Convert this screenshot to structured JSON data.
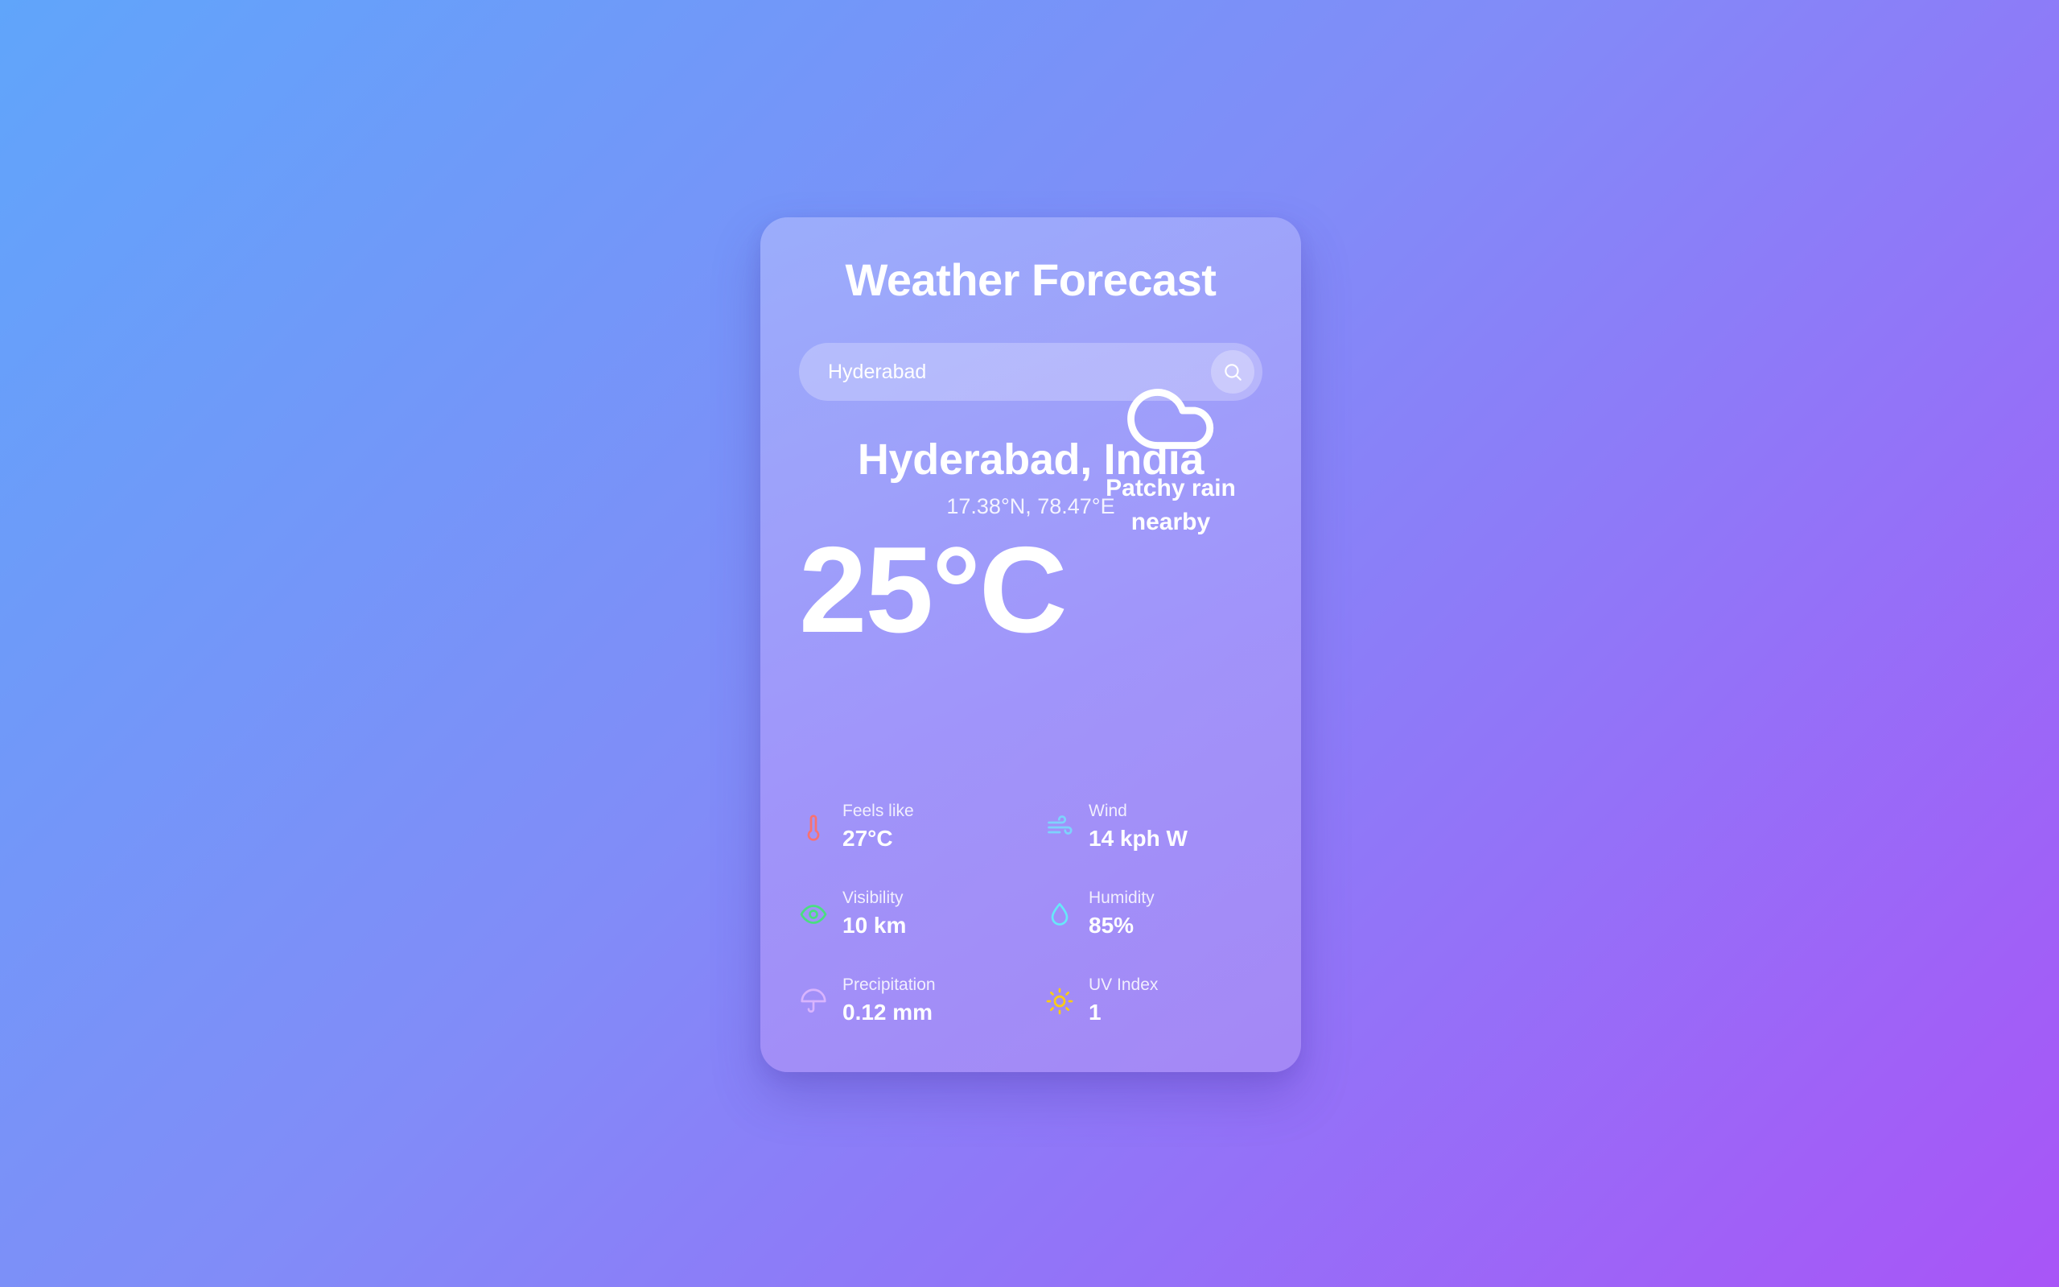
{
  "header": {
    "title": "Weather Forecast"
  },
  "search": {
    "value": "Hyderabad",
    "placeholder": "Search city",
    "button_icon": "search-icon"
  },
  "location": {
    "name": "Hyderabad, India",
    "coordinates": "17.38°N, 78.47°E"
  },
  "current": {
    "temperature": "25°C",
    "condition": "Patchy rain nearby",
    "condition_icon": "cloud-icon"
  },
  "details": [
    {
      "label": "Feels like",
      "value": "27°C",
      "icon": "thermometer-icon",
      "color": "#f87171"
    },
    {
      "label": "Wind",
      "value": "14 kph W",
      "icon": "wind-icon",
      "color": "#7dd3fc"
    },
    {
      "label": "Visibility",
      "value": "10 km",
      "icon": "eye-icon",
      "color": "#4ade80"
    },
    {
      "label": "Humidity",
      "value": "85%",
      "icon": "droplet-icon",
      "color": "#67e8f9"
    },
    {
      "label": "Precipitation",
      "value": "0.12 mm",
      "icon": "umbrella-icon",
      "color": "#d8b4fe"
    },
    {
      "label": "UV Index",
      "value": "1",
      "icon": "sun-icon",
      "color": "#facc15"
    }
  ],
  "theme": {
    "background_start": "#60a5fa",
    "background_end": "#a855f7"
  }
}
